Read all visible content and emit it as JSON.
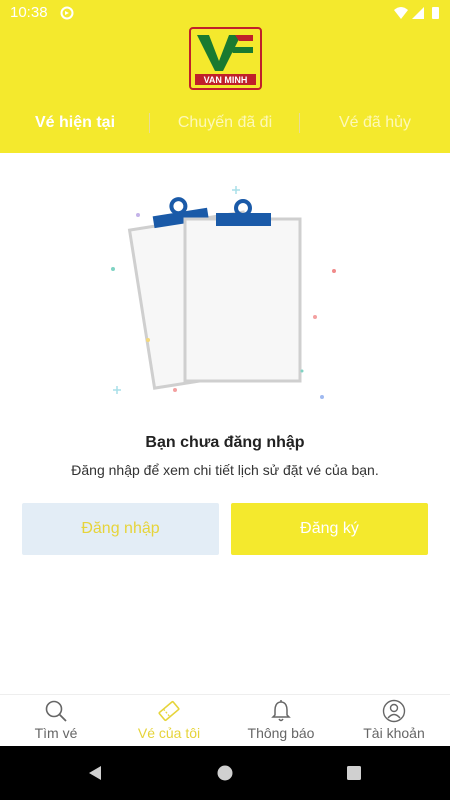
{
  "status_bar": {
    "time": "10:38"
  },
  "logo": {
    "brand_text": "VAN MINH"
  },
  "tabs": [
    {
      "label": "Vé hiện tại",
      "active": true
    },
    {
      "label": "Chuyến đã đi",
      "active": false
    },
    {
      "label": "Vé đã hủy",
      "active": false
    }
  ],
  "empty_state": {
    "title": "Bạn chưa đăng nhập",
    "subtitle": "Đăng nhập để xem chi tiết lịch sử đặt vé của bạn."
  },
  "buttons": {
    "login": "Đăng nhập",
    "register": "Đăng ký"
  },
  "bottom_nav": [
    {
      "label": "Tìm vé",
      "icon": "search-icon"
    },
    {
      "label": "Vé của tôi",
      "icon": "ticket-icon",
      "active": true
    },
    {
      "label": "Thông báo",
      "icon": "bell-icon"
    },
    {
      "label": "Tài khoản",
      "icon": "account-icon"
    }
  ],
  "colors": {
    "brand_yellow": "#f4e92d",
    "accent_blue": "#1a5aa8",
    "login_bg": "#e3edf6",
    "active_nav": "#e6d43a"
  }
}
